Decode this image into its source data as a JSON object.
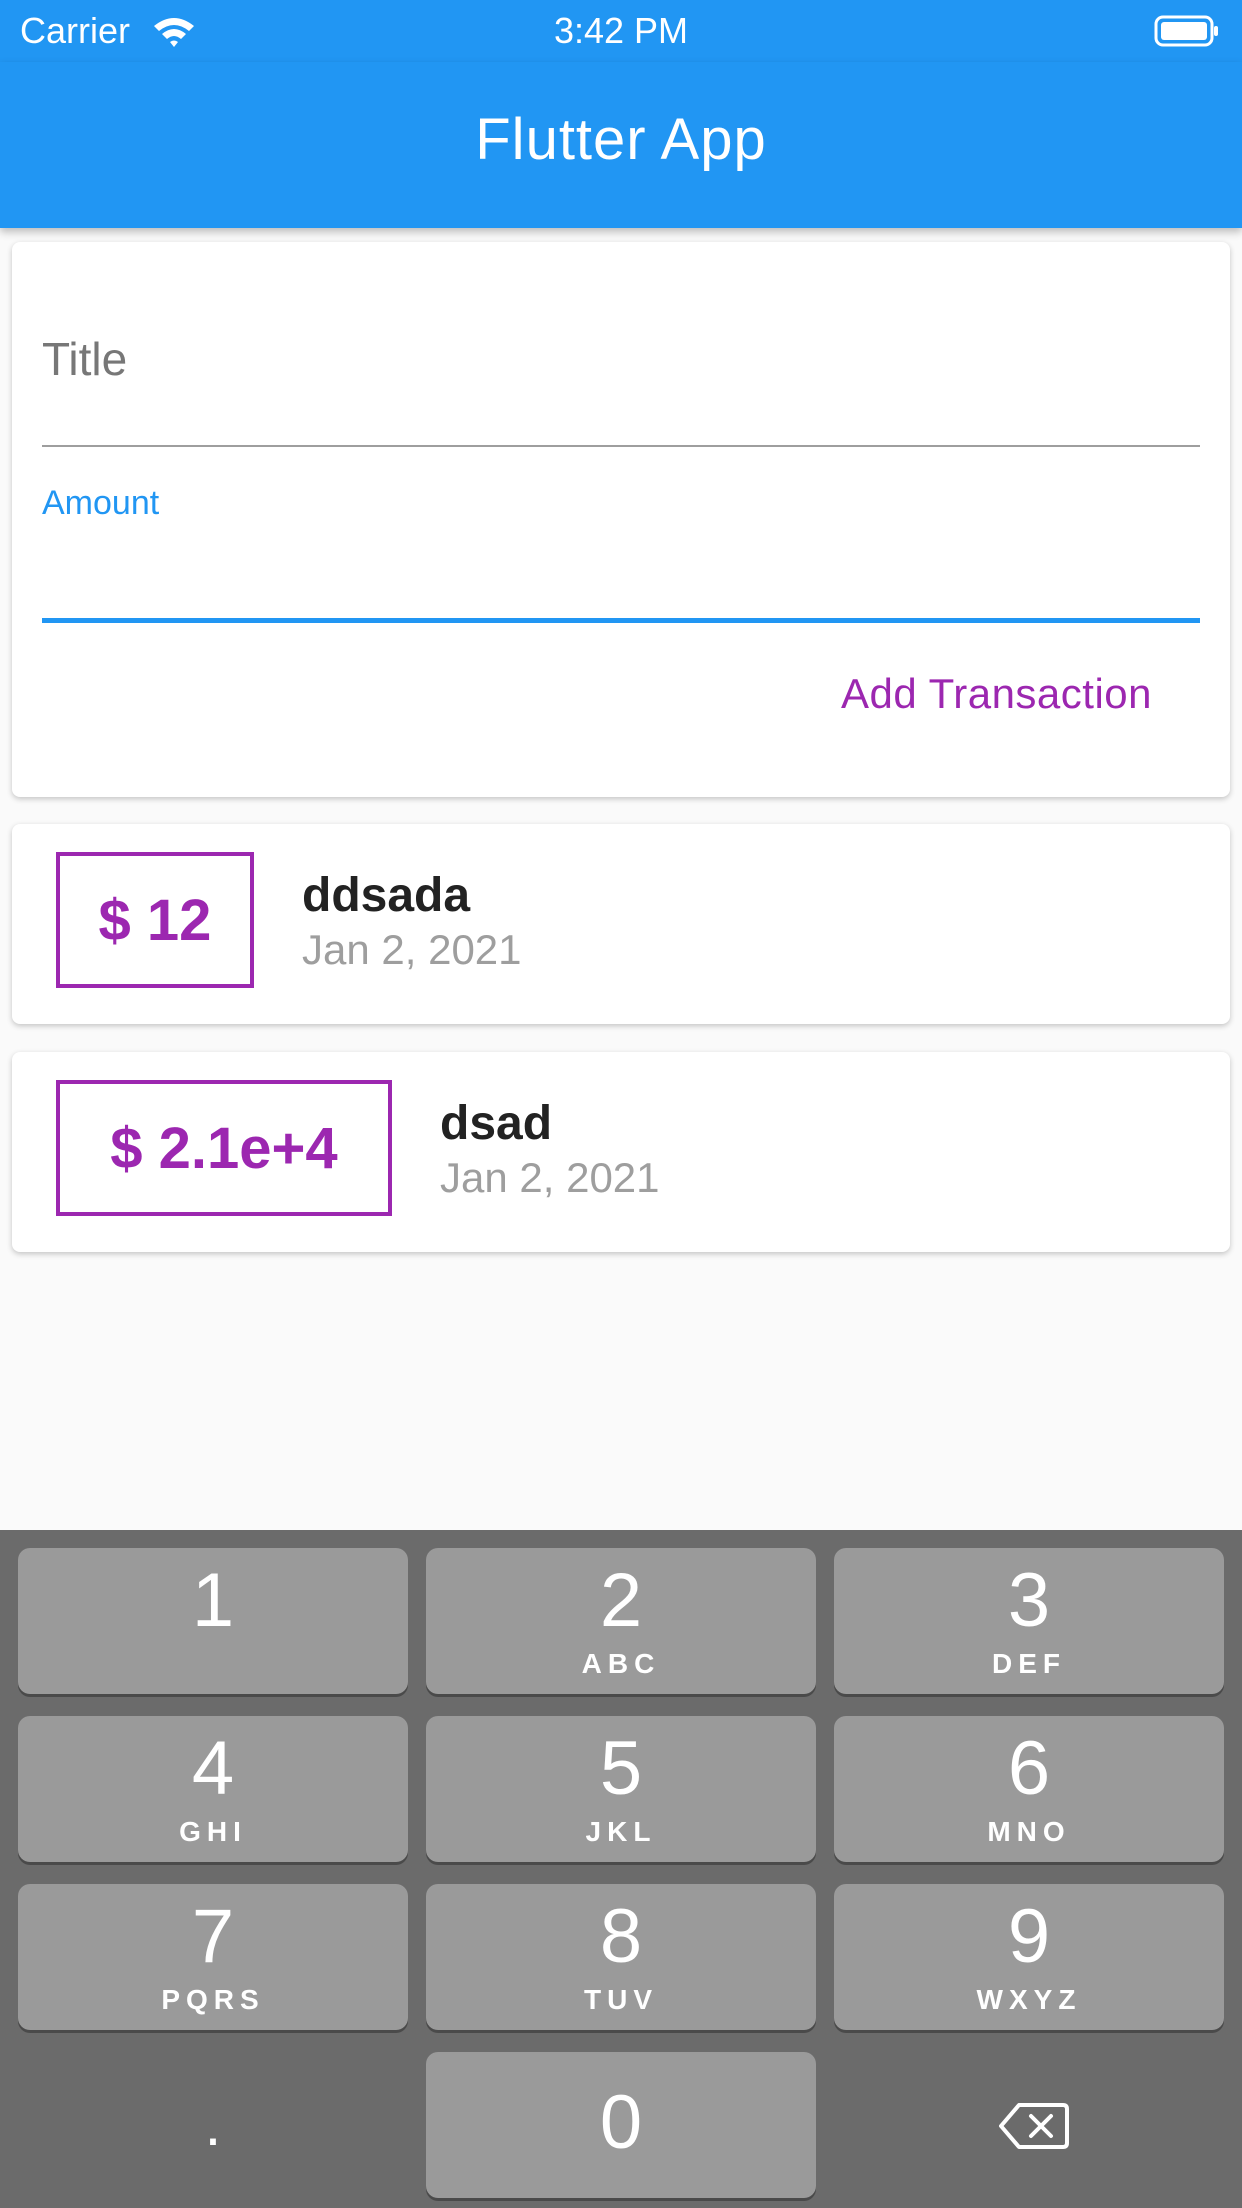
{
  "status_bar": {
    "carrier": "Carrier",
    "time": "3:42 PM",
    "wifi_icon": "wifi-icon",
    "battery_icon": "battery-icon"
  },
  "app_bar": {
    "title": "Flutter App",
    "color": "#2196f3"
  },
  "form": {
    "title_placeholder": "Title",
    "amount_label": "Amount",
    "amount_value": "",
    "submit_label": "Add Transaction",
    "accent_color": "#9c27b0"
  },
  "transactions": [
    {
      "amount": "$ 12",
      "title": "ddsada",
      "date": "Jan 2, 2021"
    },
    {
      "amount": "$ 2.1e+4",
      "title": "dsad",
      "date": "Jan 2, 2021"
    }
  ],
  "keyboard": {
    "keys": [
      {
        "digit": "1",
        "letters": ""
      },
      {
        "digit": "2",
        "letters": "ABC"
      },
      {
        "digit": "3",
        "letters": "DEF"
      },
      {
        "digit": "4",
        "letters": "GHI"
      },
      {
        "digit": "5",
        "letters": "JKL"
      },
      {
        "digit": "6",
        "letters": "MNO"
      },
      {
        "digit": "7",
        "letters": "PQRS"
      },
      {
        "digit": "8",
        "letters": "TUV"
      },
      {
        "digit": "9",
        "letters": "WXYZ"
      },
      {
        "digit": "0",
        "letters": ""
      }
    ],
    "decimal": ".",
    "delete_icon": "backspace-icon"
  }
}
